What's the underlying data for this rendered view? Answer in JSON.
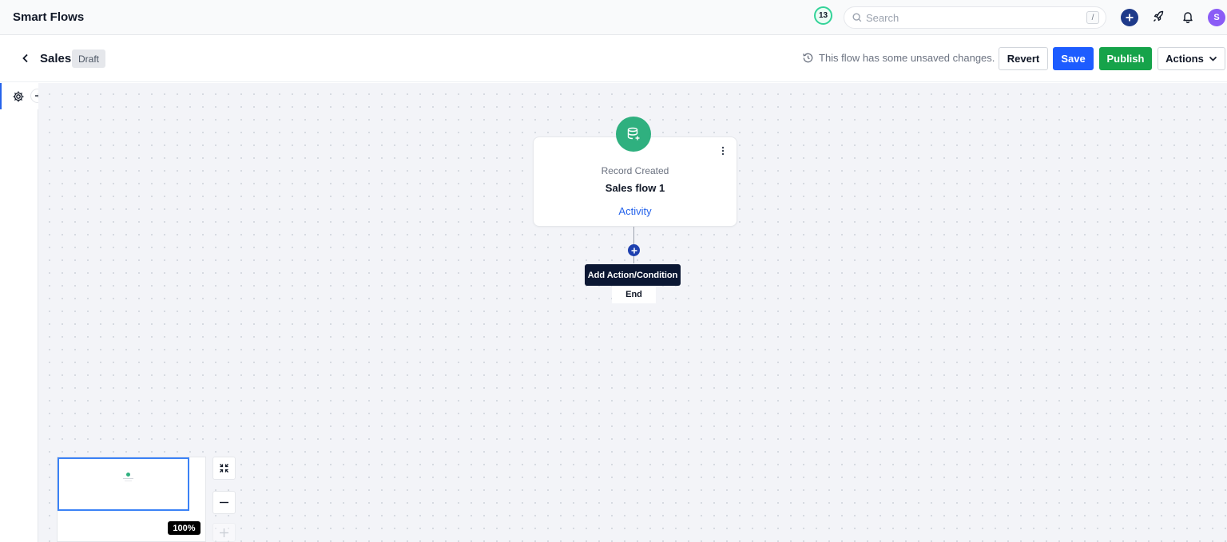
{
  "app": {
    "title": "Smart Flows"
  },
  "topbar": {
    "notification_count": "13",
    "search": {
      "placeholder": "Search",
      "shortcut": "/"
    },
    "user_initial": "S"
  },
  "flow_header": {
    "name": "Sales",
    "status": "Draft",
    "unsaved_message": "This flow has some unsaved changes.",
    "buttons": {
      "revert": "Revert",
      "save": "Save",
      "publish": "Publish",
      "actions": "Actions"
    }
  },
  "canvas": {
    "trigger_node": {
      "type": "Record Created",
      "title": "Sales flow 1",
      "link": "Activity",
      "icon": "database-plus-icon",
      "color": "#2fb07f"
    },
    "add_step_tooltip": "Add Action/Condition",
    "end_label": "End"
  },
  "minimap": {
    "zoom": "100%"
  },
  "colors": {
    "primary": "#1d5cff",
    "success": "#16a34a",
    "accent": "#2fb07f",
    "avatar": "#8b5cf6"
  }
}
